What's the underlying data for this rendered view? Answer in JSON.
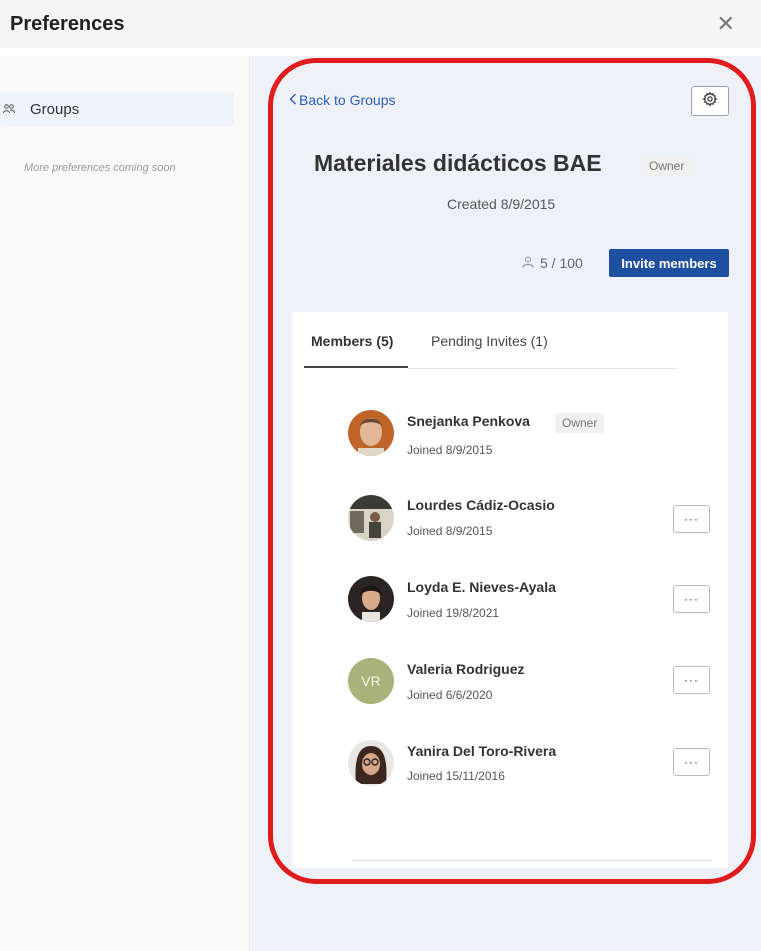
{
  "header": {
    "title": "Preferences",
    "close_glyph": "✕"
  },
  "sidebar": {
    "items": [
      {
        "label": "Groups",
        "icon": "users-icon"
      }
    ],
    "note": "More preferences coming soon"
  },
  "group": {
    "back_label": "Back to Groups",
    "title": "Materiales didácticos BAE",
    "role_badge": "Owner",
    "created": "Created 8/9/2015",
    "member_count": "5 / 100",
    "invite_label": "Invite members"
  },
  "tabs": [
    {
      "label": "Members (5)",
      "active": true
    },
    {
      "label": "Pending Invites (1)",
      "active": false
    }
  ],
  "members": [
    {
      "name": "Snejanka Penkova",
      "joined": "Joined 8/9/2015",
      "badge": "Owner",
      "avatar": "photo"
    },
    {
      "name": "Lourdes Cádiz-Ocasio",
      "joined": "Joined 8/9/2015",
      "avatar": "photo"
    },
    {
      "name": "Loyda E. Nieves-Ayala",
      "joined": "Joined 19/8/2021",
      "avatar": "photo"
    },
    {
      "name": "Valeria Rodriguez",
      "joined": "Joined 6/6/2020",
      "avatar": "initials",
      "initials": "VR"
    },
    {
      "name": "Yanira Del Toro-Rivera",
      "joined": "Joined 15/11/2016",
      "avatar": "photo"
    }
  ],
  "more_glyph": "···",
  "colors": {
    "accent": "#1f4fa0",
    "link": "#2b5db8",
    "annotation": "#e01c1c",
    "initials_bg": "#a9b27a"
  }
}
